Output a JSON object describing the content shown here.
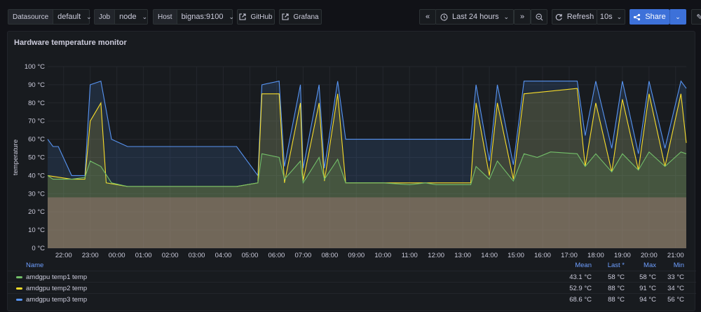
{
  "toolbar": {
    "datasource": {
      "label": "Datasource",
      "value": "default"
    },
    "job": {
      "label": "Job",
      "value": "node"
    },
    "host": {
      "label": "Host",
      "value": "bignas:9100"
    },
    "github_label": "GitHub",
    "grafana_label": "Grafana",
    "time_range": "Last 24 hours",
    "refresh_label": "Refresh",
    "refresh_interval": "10s",
    "share_label": "Share"
  },
  "panel": {
    "title": "Hardware temperature monitor"
  },
  "chart_data": {
    "type": "area",
    "title": "Hardware temperature monitor",
    "ylabel": "temperature",
    "ylim": [
      0,
      100
    ],
    "y_ticks": [
      "0 °C",
      "10 °C",
      "20 °C",
      "30 °C",
      "40 °C",
      "50 °C",
      "60 °C",
      "70 °C",
      "80 °C",
      "90 °C",
      "100 °C"
    ],
    "x_ticks": [
      "22:00",
      "23:00",
      "00:00",
      "01:00",
      "02:00",
      "03:00",
      "04:00",
      "05:00",
      "06:00",
      "07:00",
      "08:00",
      "09:00",
      "10:00",
      "11:00",
      "12:00",
      "13:00",
      "14:00",
      "15:00",
      "16:00",
      "17:00",
      "18:00",
      "19:00",
      "20:00",
      "21:00"
    ],
    "x_start_hour": 21.4,
    "x_end_hour": 45.4,
    "series": [
      {
        "name": "amdgpu temp1 temp",
        "color": "#73bf69",
        "x": [
          21.4,
          21.6,
          22.3,
          22.8,
          23.0,
          23.4,
          23.8,
          24.4,
          28.5,
          29.3,
          29.45,
          30.1,
          30.3,
          30.9,
          31.0,
          31.6,
          31.8,
          32.3,
          32.6,
          33.3,
          34.0,
          35.0,
          35.6,
          36.0,
          37.3,
          37.5,
          38.0,
          38.3,
          38.9,
          39.3,
          39.8,
          40.3,
          41.3,
          41.6,
          42.0,
          42.6,
          43.0,
          43.6,
          44.0,
          44.6,
          45.2,
          45.4
        ],
        "values": [
          40,
          38,
          38,
          39,
          48,
          45,
          36,
          34,
          34,
          36,
          52,
          50,
          38,
          48,
          36,
          50,
          38,
          49,
          36,
          36,
          36,
          35,
          36,
          35,
          35,
          45,
          38,
          48,
          37,
          52,
          50,
          53,
          52,
          45,
          52,
          42,
          52,
          43,
          53,
          45,
          53,
          52
        ]
      },
      {
        "name": "amdgpu temp2 temp",
        "color": "#fade2a",
        "x": [
          21.4,
          22.3,
          22.8,
          23.0,
          23.4,
          23.6,
          24.4,
          28.5,
          29.3,
          29.45,
          30.1,
          30.3,
          30.9,
          31.0,
          31.6,
          31.8,
          32.3,
          32.6,
          35.6,
          37.3,
          37.5,
          38.0,
          38.3,
          38.9,
          39.3,
          41.3,
          41.6,
          42.0,
          42.6,
          43.0,
          43.6,
          44.0,
          44.6,
          45.2,
          45.4
        ],
        "values": [
          40,
          38,
          38,
          70,
          80,
          36,
          34,
          34,
          36,
          85,
          85,
          36,
          80,
          37,
          80,
          37,
          85,
          36,
          36,
          36,
          80,
          40,
          80,
          38,
          85,
          88,
          45,
          80,
          42,
          82,
          43,
          85,
          45,
          85,
          58
        ]
      },
      {
        "name": "amdgpu temp3 temp",
        "color": "#5794f2",
        "x": [
          21.4,
          21.6,
          21.8,
          22.3,
          22.8,
          23.0,
          23.4,
          23.8,
          24.4,
          28.5,
          29.3,
          29.45,
          30.1,
          30.3,
          30.9,
          31.0,
          31.6,
          31.8,
          32.3,
          32.6,
          32.8,
          35.6,
          36.0,
          37.3,
          37.5,
          38.0,
          38.3,
          38.9,
          39.3,
          41.3,
          41.6,
          42.0,
          42.6,
          43.0,
          43.6,
          44.0,
          44.6,
          45.2,
          45.4
        ],
        "values": [
          60,
          56,
          56,
          40,
          40,
          90,
          92,
          60,
          56,
          56,
          40,
          90,
          92,
          45,
          90,
          44,
          90,
          44,
          92,
          60,
          60,
          60,
          60,
          60,
          90,
          48,
          90,
          46,
          92,
          92,
          62,
          92,
          55,
          92,
          52,
          92,
          55,
          92,
          88
        ]
      }
    ],
    "base_band_value": 28,
    "legend": {
      "placement": "bottom",
      "columns": [
        "Name",
        "Mean",
        "Last *",
        "Max",
        "Min"
      ],
      "rows": [
        {
          "name": "amdgpu temp1 temp",
          "color": "#73bf69",
          "mean": "43.1 °C",
          "last": "58 °C",
          "max": "58 °C",
          "min": "33 °C"
        },
        {
          "name": "amdgpu temp2 temp",
          "color": "#fade2a",
          "mean": "52.9 °C",
          "last": "88 °C",
          "max": "91 °C",
          "min": "34 °C"
        },
        {
          "name": "amdgpu temp3 temp",
          "color": "#5794f2",
          "mean": "68.6 °C",
          "last": "88 °C",
          "max": "94 °C",
          "min": "56 °C"
        }
      ]
    }
  }
}
